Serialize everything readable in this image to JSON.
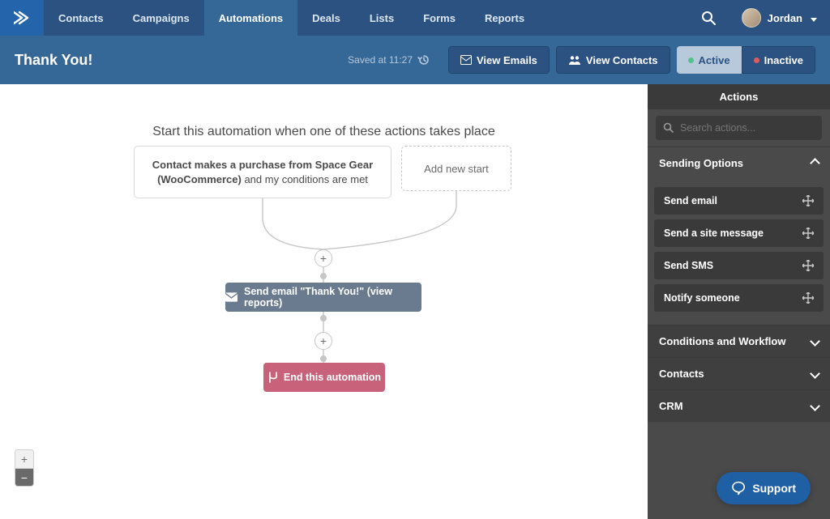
{
  "nav": {
    "items": [
      "Contacts",
      "Campaigns",
      "Automations",
      "Deals",
      "Lists",
      "Forms",
      "Reports"
    ],
    "active_index": 2,
    "user_name": "Jordan"
  },
  "subheader": {
    "title": "Thank You!",
    "saved_label": "Saved at 11:27",
    "view_emails": "View Emails",
    "view_contacts": "View Contacts",
    "active": "Active",
    "inactive": "Inactive"
  },
  "canvas": {
    "instruction": "Start this automation when one of these actions takes place",
    "trigger_bold": "Contact makes a purchase from Space Gear (WooCommerce)",
    "trigger_rest": " and my conditions are met",
    "add_start": "Add new start",
    "send_step": "Send email \"Thank You!\" (view reports)",
    "end_step": "End this automation"
  },
  "sidebar": {
    "header": "Actions",
    "search_placeholder": "Search actions...",
    "sections": {
      "sending": "Sending Options",
      "conditions": "Conditions and Workflow",
      "contacts": "Contacts",
      "crm": "CRM"
    },
    "sending_actions": [
      "Send email",
      "Send a site message",
      "Send SMS",
      "Notify someone"
    ]
  },
  "zoom": {
    "in": "+",
    "out": "−"
  },
  "support": {
    "label": "Support"
  }
}
